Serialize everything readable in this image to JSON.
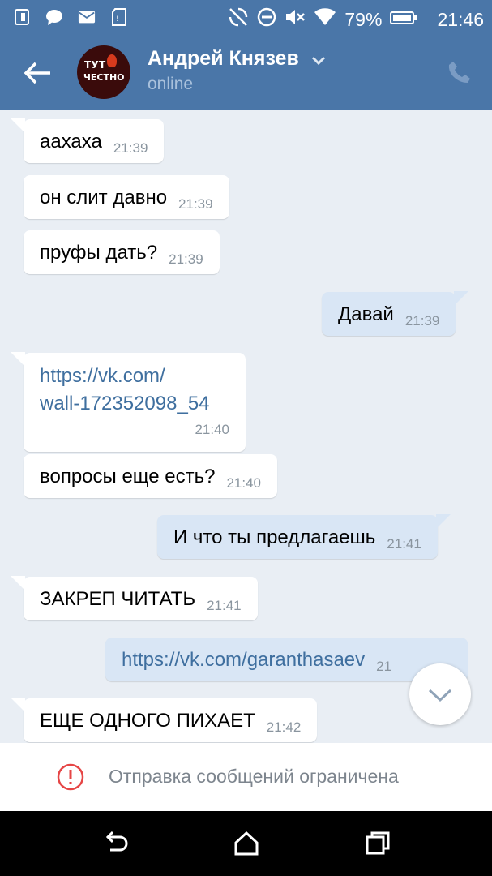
{
  "status": {
    "battery": "79%",
    "time": "21:46",
    "icons": [
      "sim-icon",
      "chat-bubble-icon",
      "mail-icon",
      "sd-card-icon",
      "no-sync-icon",
      "dnd-icon",
      "mute-icon",
      "wifi-icon",
      "battery-icon"
    ]
  },
  "header": {
    "contact_name": "Андрей Князев",
    "status": "online",
    "avatar_text_line1": "ТУТ",
    "avatar_text_line2": "ЧЕСТНО"
  },
  "messages": [
    {
      "dir": "in",
      "text": "аахаха",
      "time": "21:39"
    },
    {
      "dir": "in",
      "text": "он слит давно",
      "time": "21:39"
    },
    {
      "dir": "in",
      "text": "пруфы дать?",
      "time": "21:39"
    },
    {
      "dir": "out",
      "text": "Давай",
      "time": "21:39"
    },
    {
      "dir": "in",
      "link_line1": "https://vk.com/",
      "link_line2": "wall-172352098_54",
      "time": "21:40"
    },
    {
      "dir": "in",
      "text": "вопросы еще есть?",
      "time": "21:40"
    },
    {
      "dir": "out",
      "text": "И что ты предлагаешь",
      "time": "21:41"
    },
    {
      "dir": "in",
      "text": "ЗАКРЕП ЧИТАТЬ",
      "time": "21:41"
    },
    {
      "dir": "out",
      "link": "https://vk.com/garanthasaev",
      "time": "21"
    },
    {
      "dir": "in",
      "text": "ЕЩЕ ОДНОГО ПИХАЕТ",
      "time": "21:42"
    }
  ],
  "composer": {
    "restricted_text": "Отправка сообщений ограничена"
  },
  "colors": {
    "accent": "#4a76a8",
    "chat_bg": "#e9eef4",
    "outgoing_bubble": "#d9e6f5",
    "warning": "#e64646"
  }
}
